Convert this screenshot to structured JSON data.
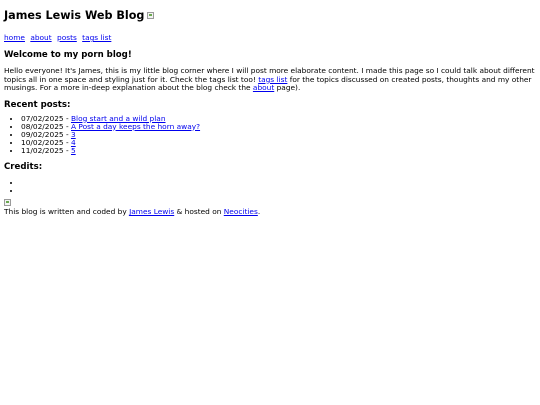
{
  "header": {
    "title": "James Lewis Web Blog"
  },
  "nav": {
    "home": "home",
    "about": "about",
    "posts": "posts",
    "tags": "tags list"
  },
  "welcome": {
    "heading": "Welcome to my porn blog!",
    "intro_part1": "Hello everyone! It's James, this is my little blog corner where I will post more elaborate content. I made this page so I could talk about different topics all in one space and styling just for it. Check the tags list too! ",
    "tags_link": "tags list",
    "intro_part2": " for the topics discussed on created posts, thoughts and my other musings. For a more in-deep explanation about the blog check the ",
    "about_link": "about",
    "intro_part3": " page)."
  },
  "recent": {
    "heading": "Recent posts:",
    "posts": [
      {
        "date": "07/02/2025",
        "sep": " - ",
        "title": "Blog start and a wild plan"
      },
      {
        "date": "08/02/2025",
        "sep": " - ",
        "title": "A Post a day keeps the horn away?"
      },
      {
        "date": "09/02/2025",
        "sep": " - ",
        "title": "3"
      },
      {
        "date": "10/02/2025",
        "sep": " - ",
        "title": "4"
      },
      {
        "date": "11/02/2025",
        "sep": " - ",
        "title": "5"
      }
    ]
  },
  "credits": {
    "heading": "Credits:"
  },
  "footer": {
    "text_before": "This blog is written and coded by ",
    "author_link": "James Lewis",
    "text_middle": " & hosted on ",
    "host_link": "Neocities",
    "text_after": "."
  }
}
